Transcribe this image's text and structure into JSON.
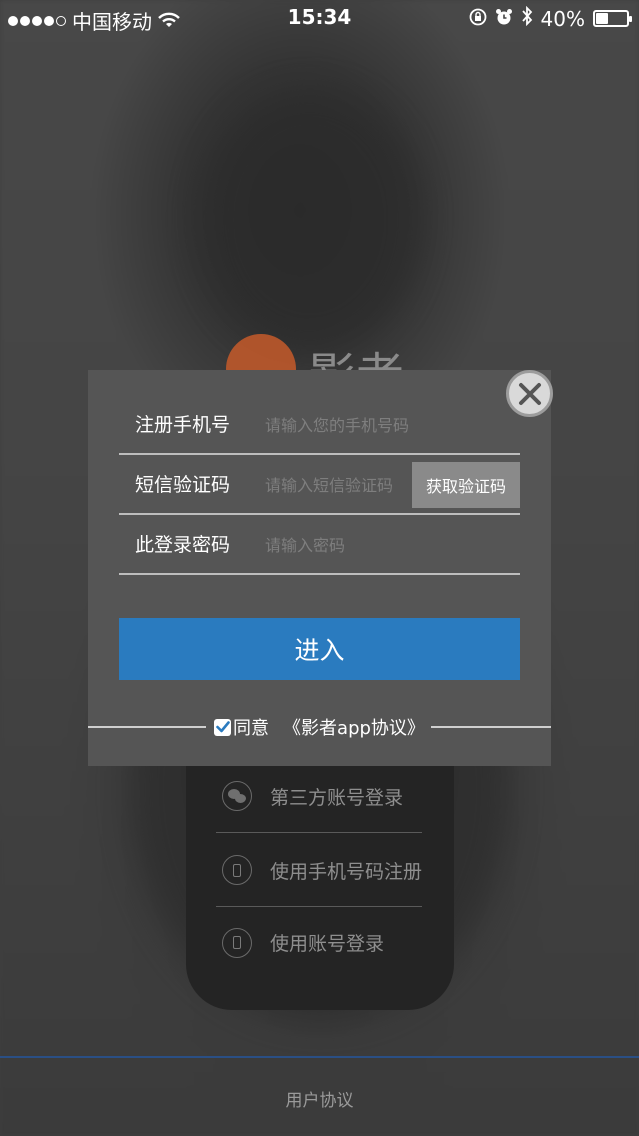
{
  "status_bar": {
    "carrier": "中国移动",
    "time": "15:34",
    "battery_percent": "40%",
    "battery_level": 0.4,
    "icons": [
      "signal-dots-icon",
      "wifi-icon",
      "orientation-lock-icon",
      "alarm-icon",
      "bluetooth-icon",
      "battery-icon"
    ]
  },
  "logo": {
    "text": "影者"
  },
  "dialog": {
    "phone_label": "注册手机号",
    "phone_placeholder": "请输入您的手机号码",
    "code_label": "短信验证码",
    "code_placeholder": "请输入短信验证码",
    "get_code_label": "获取验证码",
    "password_label": "此登录密码",
    "password_placeholder": "请输入密码",
    "enter_label": "进入",
    "agree_label": "同意",
    "agree_checked": true,
    "agreement_link": "《影者app协议》"
  },
  "options": [
    {
      "label": "第三方账号登录",
      "icon": "wechat-icon"
    },
    {
      "label": "使用手机号码注册",
      "icon": "phone-icon"
    },
    {
      "label": "使用账号登录",
      "icon": "phone-icon"
    }
  ],
  "footer": {
    "link": "用户协议"
  },
  "colors": {
    "accent_blue": "#2a7bbf",
    "dialog_bg": "#555555",
    "panel_bg": "#242424"
  }
}
